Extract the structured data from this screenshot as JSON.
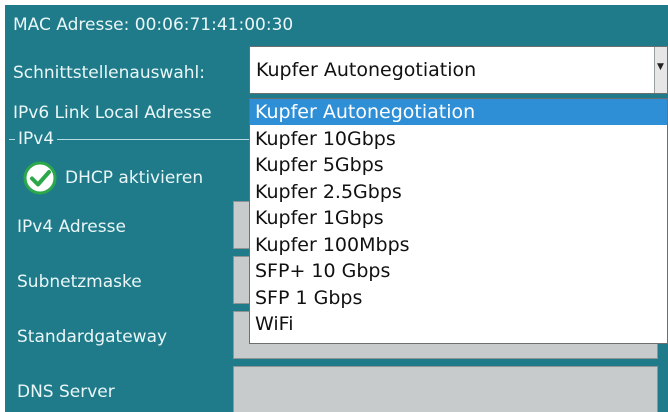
{
  "network": {
    "mac_label": "MAC Adresse: 00:06:71:41:00:30",
    "interface_label": "Schnittstellenauswahl:",
    "interface_value": "Kupfer Autonegotiation",
    "ipv6_label": "IPv6 Link Local Adresse",
    "ipv4_group": "IPv4",
    "dhcp_label": "DHCP aktivieren",
    "dhcp_checked": true,
    "fields": [
      {
        "label": "IPv4 Adresse",
        "value": ""
      },
      {
        "label": "Subnetzmaske",
        "value": ""
      },
      {
        "label": "Standardgateway",
        "value": ""
      },
      {
        "label": "DNS Server",
        "value": ""
      }
    ]
  },
  "dropdown": {
    "options": [
      "Kupfer Autonegotiation",
      "Kupfer 10Gbps",
      "Kupfer 5Gbps",
      "Kupfer 2.5Gbps",
      "Kupfer 1Gbps",
      "Kupfer 100Mbps",
      "SFP+ 10 Gbps",
      "SFP 1 Gbps",
      "WiFi"
    ],
    "selected_index": 0
  },
  "colors": {
    "panel": "#1f7b8a",
    "text": "#eaf6f7",
    "input_bg": "#c8cbcc",
    "highlight": "#2f8fd6",
    "check_green": "#2ca84a"
  },
  "icons": {
    "dhcp": "check-circle-icon",
    "dropdown": "chevron-down-icon"
  }
}
